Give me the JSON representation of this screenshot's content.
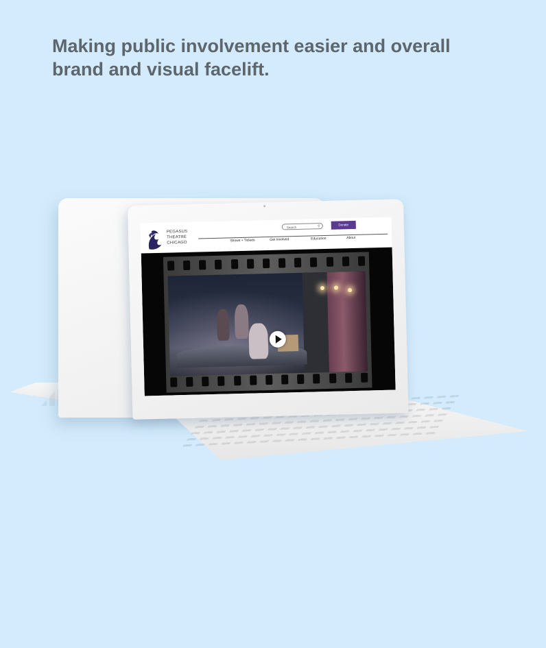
{
  "headline": "Making public involvement easier and overall brand and visual facelift.",
  "website": {
    "logo": {
      "icon": "phoenix-logo-icon",
      "lines": [
        "PEGASUS",
        "THEATRE",
        "CHICAGO"
      ]
    },
    "search": {
      "placeholder": "Search",
      "icon": "search-icon"
    },
    "donate_label": "Donate",
    "nav": [
      "Shows + Tickets",
      "Get Involved",
      "Education",
      "About"
    ],
    "hero": {
      "play_icon": "play-icon"
    }
  },
  "colors": {
    "background": "#d3ebfc",
    "headline": "#5d666d",
    "donate": "#5b3b8f",
    "logo": "#2a2463"
  }
}
